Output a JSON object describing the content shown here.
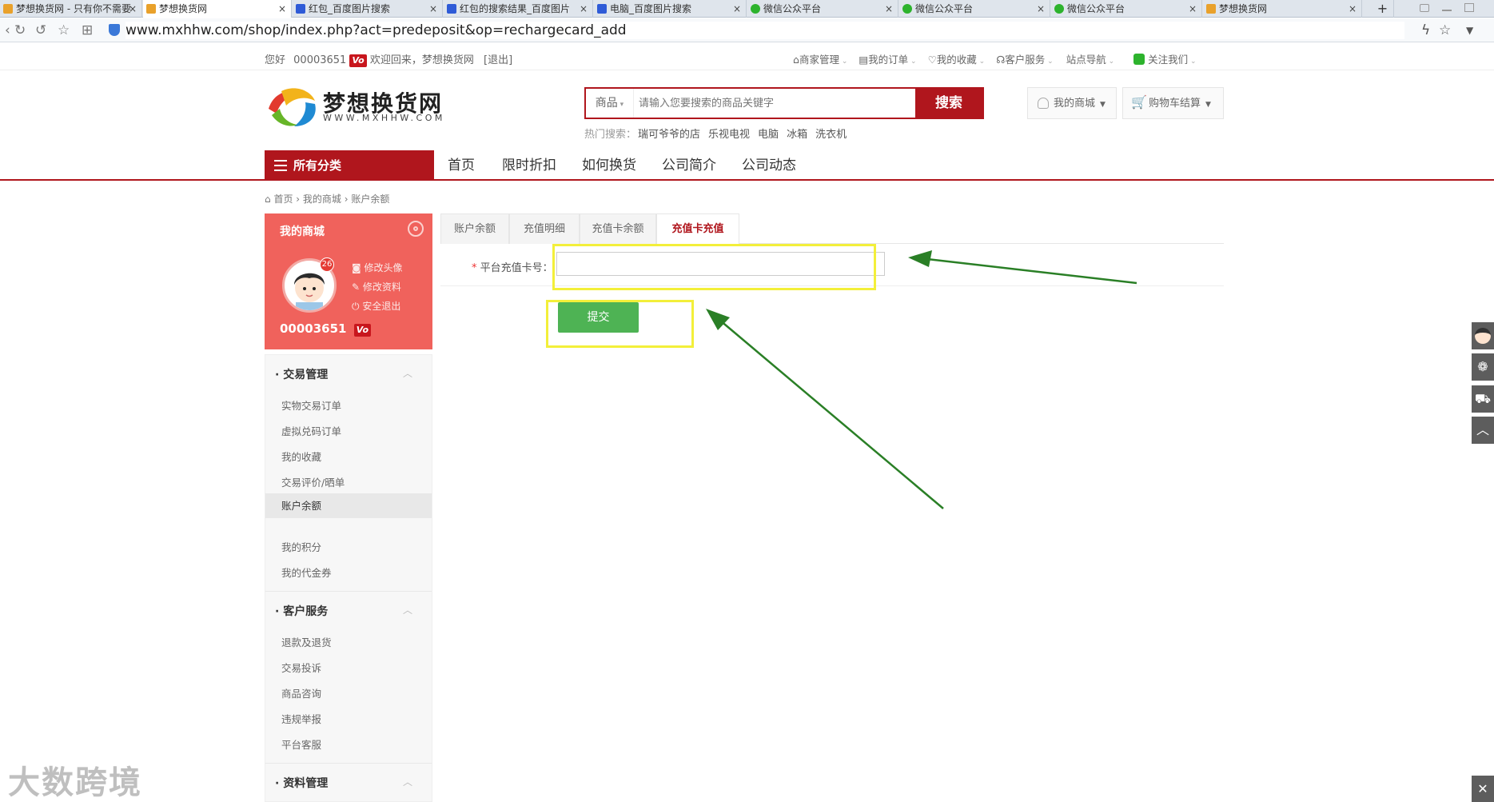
{
  "browser": {
    "tabs": [
      {
        "title": "梦想换货网 - 只有你不需要",
        "close": "×",
        "color": "#e9a12b"
      },
      {
        "title": "梦想换货网",
        "close": "×",
        "color": "#e9a12b"
      },
      {
        "title": "红包_百度图片搜索",
        "close": "×",
        "color": "#2f5bd7"
      },
      {
        "title": "红包的搜索结果_百度图片",
        "close": "×",
        "color": "#2f5bd7"
      },
      {
        "title": "电脑_百度图片搜索",
        "close": "×",
        "color": "#2f5bd7"
      },
      {
        "title": "微信公众平台",
        "close": "×",
        "color": "#2db32d"
      },
      {
        "title": "微信公众平台",
        "close": "×",
        "color": "#2db32d"
      },
      {
        "title": "微信公众平台",
        "close": "×",
        "color": "#2db32d"
      },
      {
        "title": "梦想换货网",
        "close": "×",
        "color": "#e9a12b"
      }
    ],
    "new_tab": "+",
    "url": "www.mxhhw.com/shop/index.php?act=predeposit&op=rechargecard_add"
  },
  "topbar": {
    "greeting": "您好",
    "user_id": "00003651",
    "vip_badge": "Vo",
    "welcome": "欢迎回来，梦想换货网",
    "logout": "[退出]",
    "links": [
      "商家管理",
      "我的订单",
      "我的收藏",
      "客户服务",
      "站点导航",
      "关注我们"
    ]
  },
  "header": {
    "logo_text": "梦想换货网",
    "logo_sub": "WWW.MXHHW.COM",
    "search_category": "商品",
    "search_placeholder": "请输入您要搜索的商品关键字",
    "search_button": "搜索",
    "hot_label": "热门搜索：",
    "hot_terms": [
      "瑞可爷爷的店",
      "乐视电视",
      "电脑",
      "冰箱",
      "洗衣机"
    ],
    "my_mall": "我的商城",
    "cart": "购物车结算"
  },
  "nav": {
    "all_categories": "所有分类",
    "items": [
      "首页",
      "限时折扣",
      "如何换货",
      "公司简介",
      "公司动态"
    ]
  },
  "breadcrumb": [
    "首页",
    "我的商城",
    "账户余额"
  ],
  "sidebar": {
    "title": "我的商城",
    "badge_count": "26",
    "links": [
      "修改头像",
      "修改资料",
      "安全退出"
    ],
    "username": "00003651",
    "vip_badge": "Vo",
    "groups": [
      {
        "title": "交易管理",
        "items": [
          "实物交易订单",
          "虚拟兑码订单",
          "我的收藏",
          "交易评价/晒单",
          "账户余额",
          "我的积分",
          "我的代金券"
        ]
      },
      {
        "title": "客户服务",
        "items": [
          "退款及退货",
          "交易投诉",
          "商品咨询",
          "违规举报",
          "平台客服"
        ]
      },
      {
        "title": "资料管理",
        "items": []
      }
    ],
    "active_item": "账户余额"
  },
  "content": {
    "tabs": [
      "账户余额",
      "充值明细",
      "充值卡余额",
      "充值卡充值"
    ],
    "active_tab": "充值卡充值",
    "field_required_mark": "*",
    "field_label": "平台充值卡号：",
    "field_value": "",
    "submit_label": "提交"
  },
  "watermark": "大数跨境",
  "colors": {
    "brand_red": "#b0161d",
    "sidebar_red": "#f0625c",
    "submit_green": "#4eb354",
    "highlight_yellow": "#f3ef3a",
    "arrow_green": "#2a7f26"
  }
}
